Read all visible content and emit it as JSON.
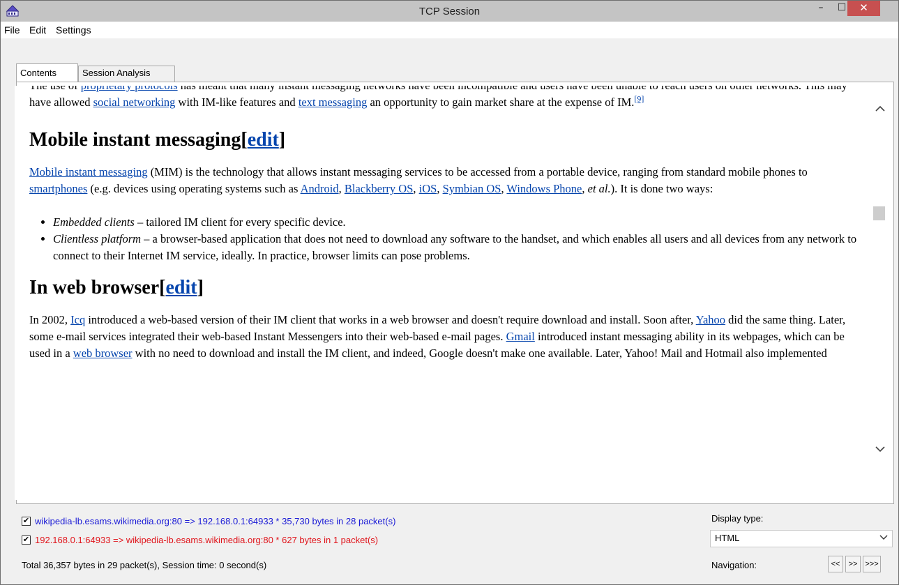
{
  "window": {
    "title": "TCP Session",
    "minimize_glyph": "–",
    "maximize_glyph": "☐",
    "close_glyph": "✕"
  },
  "menu": {
    "items": [
      "File",
      "Edit",
      "Settings"
    ]
  },
  "tabs": {
    "items": [
      "Contents",
      "Session Analysis"
    ],
    "active": "Contents"
  },
  "content": {
    "intro_part1": "The use of ",
    "intro_link1": "proprietary protocols",
    "intro_part2": " has meant that many instant messaging networks have been incompatible and users have been unable to reach users on other networks. This may have allowed ",
    "intro_link2": "social networking",
    "intro_part3": " with IM-like features and ",
    "intro_link3": "text messaging",
    "intro_part4": " an opportunity to gain market share at the expense of IM.",
    "intro_ref": "[9]",
    "h_mobile": "Mobile instant messaging",
    "edit_bracket_open": "[",
    "edit_label": "edit",
    "edit_bracket_close": "]",
    "mim_link": "Mobile instant messaging",
    "mim_part1": " (MIM) is the technology that allows instant messaging services to be accessed from a portable device, ranging from standard mobile phones to ",
    "mim_link2": "smartphones",
    "mim_part2": " (e.g. devices using operating systems such as ",
    "mim_link3": "Android",
    "mim_sep1": ", ",
    "mim_link4": "Blackberry OS",
    "mim_sep2": ", ",
    "mim_link5": "iOS",
    "mim_sep3": ", ",
    "mim_link6": "Symbian OS",
    "mim_sep4": ", ",
    "mim_link7": "Windows Phone",
    "mim_sep5": ", ",
    "mim_etal": "et al.",
    "mim_part3": "). It is done two ways:",
    "bullet1_em": "Embedded clients",
    "bullet1_text": " – tailored IM client for every specific device.",
    "bullet2_em": "Clientless platform",
    "bullet2_text": " – a browser-based application that does not need to download any software to the handset, and which enables all users and all devices from any network to connect to their Internet IM service, ideally. In practice, browser limits can pose problems.",
    "h_web": "In web browser",
    "web_part1": "In 2002, ",
    "web_link1": "Icq",
    "web_part2": " introduced a web-based version of their IM client that works in a web browser and doesn't require download and install. Soon after, ",
    "web_link2": "Yahoo",
    "web_part3": " did the same thing. Later, some e-mail services integrated their web-based Instant Messengers into their web-based e-mail pages. ",
    "web_link3": "Gmail",
    "web_part4": " introduced instant messaging ability in its webpages, which can be used in a ",
    "web_link4": "web browser",
    "web_part5": " with no need to download and install the IM client, and indeed, Google doesn't make one available. Later, Yahoo! Mail and Hotmail also implemented"
  },
  "scrollbar": {
    "up_glyph": "^",
    "down_glyph": "v"
  },
  "status": {
    "stream1": {
      "checked": true,
      "text": "wikipedia-lb.esams.wikimedia.org:80 => 192.168.0.1:64933 * 35,730 bytes in 28 packet(s)",
      "color": "#1a1ad6"
    },
    "stream2": {
      "checked": true,
      "text": "192.168.0.1:64933 => wikipedia-lb.esams.wikimedia.org:80 * 627 bytes in 1 packet(s)",
      "color": "#e0141b"
    },
    "check_glyph": "✔",
    "total": "Total 36,357 bytes in 29 packet(s), Session time: 0 second(s)",
    "display_type_label": "Display type:",
    "display_type_value": "HTML",
    "display_type_arrow": "⌄",
    "navigation_label": "Navigation:",
    "nav_buttons": [
      "<<",
      ">>",
      ">>>"
    ]
  },
  "colors": {
    "link": "#0645ad",
    "close_button": "#c75050",
    "titlebar": "#c4c4c4"
  }
}
